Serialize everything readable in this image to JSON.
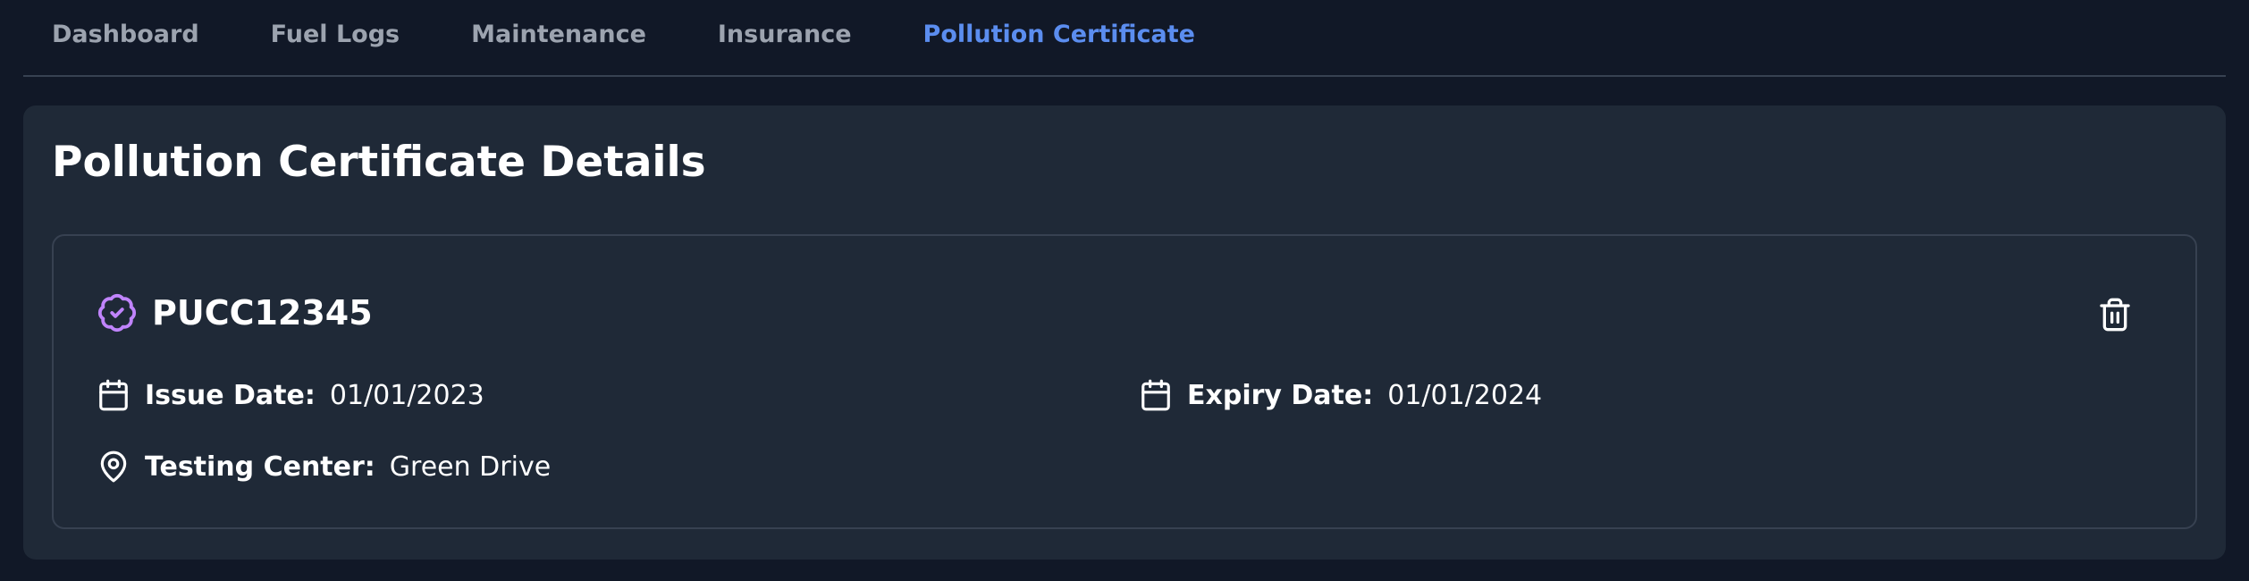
{
  "tabs": [
    {
      "label": "Dashboard",
      "active": false
    },
    {
      "label": "Fuel Logs",
      "active": false
    },
    {
      "label": "Maintenance",
      "active": false
    },
    {
      "label": "Insurance",
      "active": false
    },
    {
      "label": "Pollution Certificate",
      "active": true
    }
  ],
  "page": {
    "title": "Pollution Certificate Details"
  },
  "certificate": {
    "number": "PUCC12345",
    "badge_icon": "badge-check-icon",
    "issue_label": "Issue Date:",
    "issue_value": "01/01/2023",
    "expiry_label": "Expiry Date:",
    "expiry_value": "01/01/2024",
    "center_label": "Testing Center:",
    "center_value": "Green Drive",
    "delete_icon": "trash-icon"
  },
  "colors": {
    "background": "#111827",
    "panel": "#1f2937",
    "border": "#374151",
    "tab_inactive": "#9ca3af",
    "tab_active": "#5b8def",
    "badge": "#c084fc"
  }
}
